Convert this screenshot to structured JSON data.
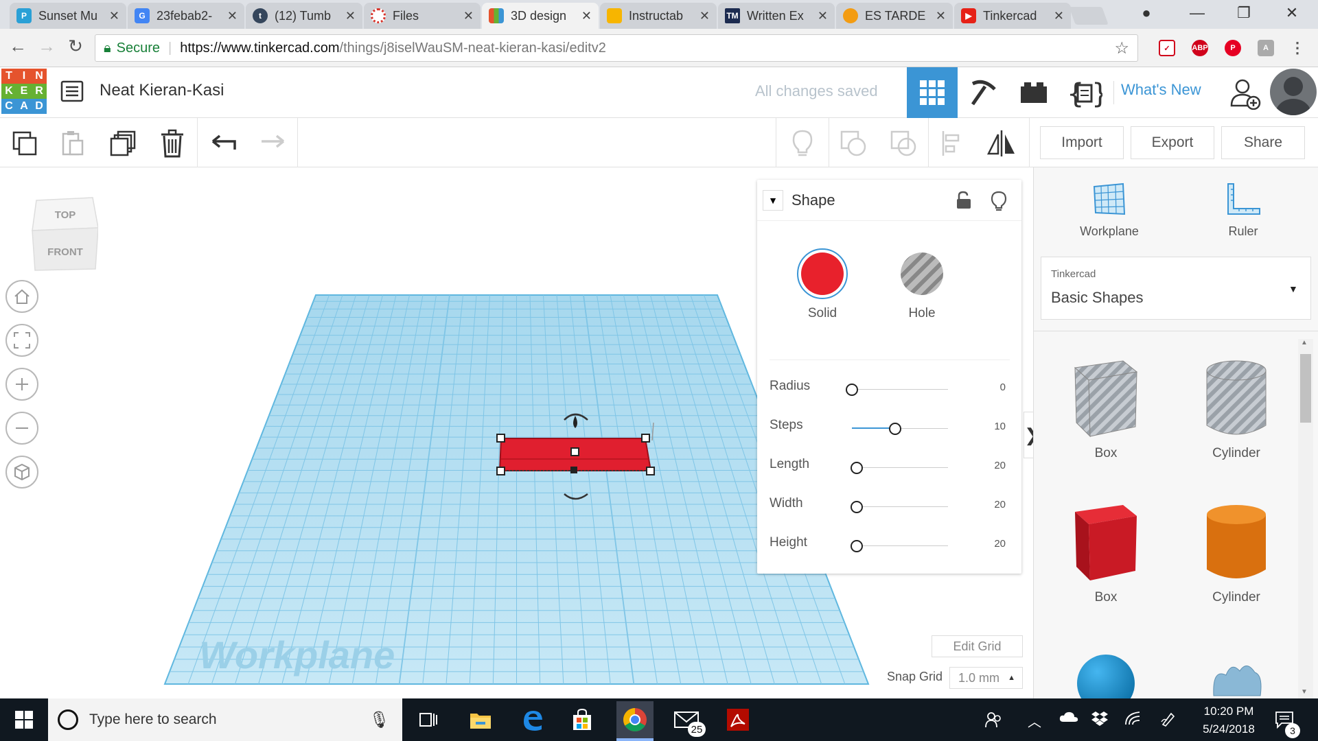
{
  "browser": {
    "tabs": [
      {
        "title": "Sunset Mu",
        "active": false
      },
      {
        "title": "23febab2-",
        "active": false
      },
      {
        "title": "(12) Tumb",
        "active": false
      },
      {
        "title": "Files",
        "active": false
      },
      {
        "title": "3D design",
        "active": true
      },
      {
        "title": "Instructab",
        "active": false
      },
      {
        "title": "Written Ex",
        "active": false
      },
      {
        "title": "ES TARDE",
        "active": false
      },
      {
        "title": "Tinkercad",
        "active": false
      }
    ],
    "tab_favicons": [
      "P",
      "G",
      "t",
      "",
      "",
      "",
      "TM",
      "",
      ""
    ],
    "url": {
      "security_label": "Secure",
      "scheme_host": "https://www.tinkercad.com",
      "path": "/things/j8iselWauSM-neat-kieran-kasi/editv2"
    },
    "extensions": [
      "ABP"
    ]
  },
  "app": {
    "logo_letters": [
      "T",
      "I",
      "N",
      "K",
      "E",
      "R",
      "C",
      "A",
      "D"
    ],
    "logo_colors": [
      "#e5532d",
      "#e5532d",
      "#e5532d",
      "#66b132",
      "#66b132",
      "#66b132",
      "#3b95d5",
      "#3b95d5",
      "#3b95d5"
    ],
    "design_title": "Neat Kieran-Kasi",
    "save_status": "All changes saved",
    "whats_new": "What's New",
    "accent_color": "#3b95d5"
  },
  "toolbar": {
    "import_label": "Import",
    "export_label": "Export",
    "share_label": "Share"
  },
  "viewport": {
    "viewcube_top": "TOP",
    "viewcube_front": "FRONT",
    "workplane_label": "Workplane",
    "selected_object_color": "#e01f2f",
    "grid_color": "#8fd0ec"
  },
  "inspector": {
    "title": "Shape",
    "solid_label": "Solid",
    "hole_label": "Hole",
    "solid_color": "#e8212c",
    "params": [
      {
        "label": "Radius",
        "value": "0",
        "fraction": 0.0
      },
      {
        "label": "Steps",
        "value": "10",
        "fraction": 0.45
      },
      {
        "label": "Length",
        "value": "20",
        "fraction": 0.05
      },
      {
        "label": "Width",
        "value": "20",
        "fraction": 0.05
      },
      {
        "label": "Height",
        "value": "20",
        "fraction": 0.05
      }
    ],
    "edit_grid_label": "Edit Grid",
    "snap_grid_label": "Snap Grid",
    "snap_grid_value": "1.0 mm"
  },
  "right_panel": {
    "workplane_label": "Workplane",
    "ruler_label": "Ruler",
    "library_source": "Tinkercad",
    "library_name": "Basic Shapes",
    "shapes": [
      {
        "label": "Box",
        "kind": "box-hole"
      },
      {
        "label": "Cylinder",
        "kind": "cylinder-hole"
      },
      {
        "label": "Box",
        "kind": "box-solid"
      },
      {
        "label": "Cylinder",
        "kind": "cylinder-solid"
      }
    ]
  },
  "taskbar": {
    "search_placeholder": "Type here to search",
    "mail_badge": "25",
    "time": "10:20 PM",
    "date": "5/24/2018",
    "notification_count": "3"
  }
}
